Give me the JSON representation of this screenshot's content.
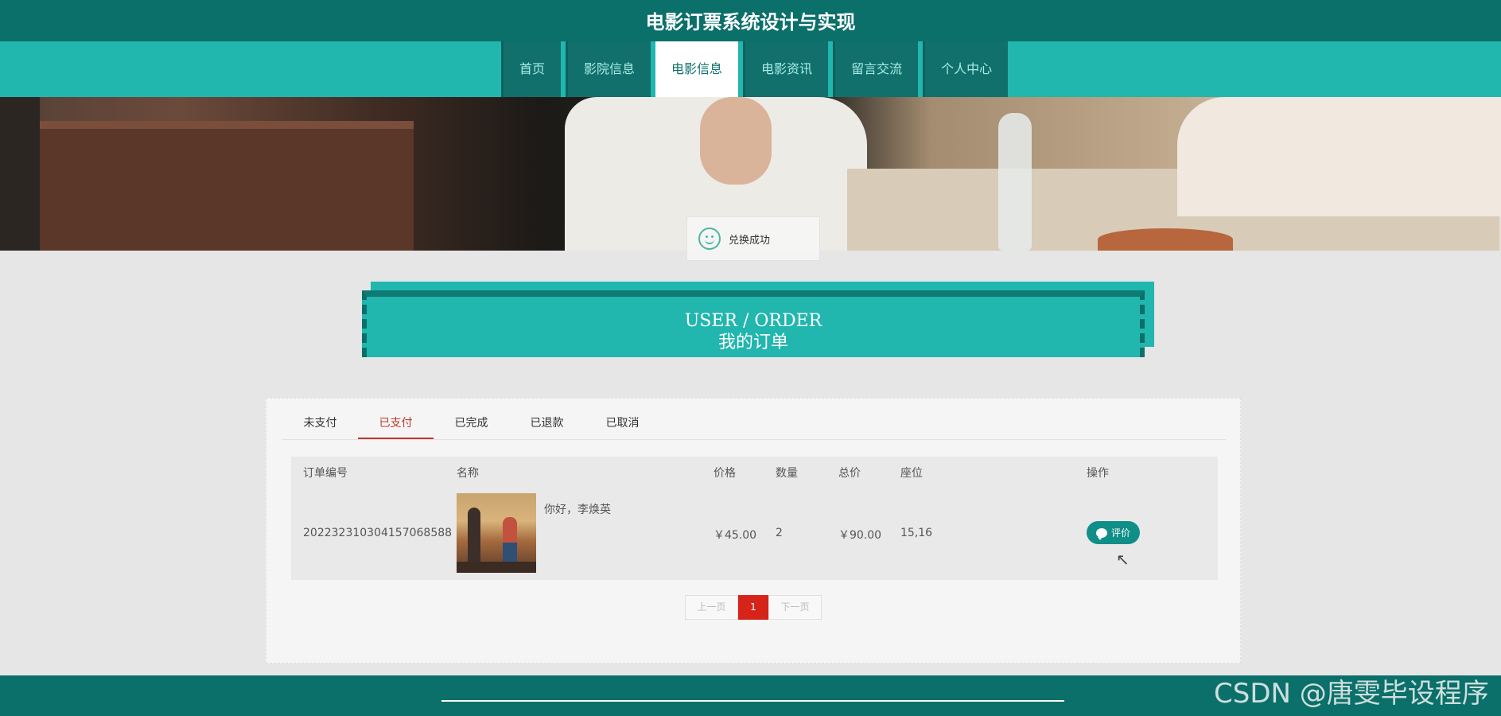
{
  "header": {
    "title": "电影订票系统设计与实现"
  },
  "nav": {
    "items": [
      {
        "label": "首页"
      },
      {
        "label": "影院信息"
      },
      {
        "label": "电影信息"
      },
      {
        "label": "电影资讯"
      },
      {
        "label": "留言交流"
      },
      {
        "label": "个人中心"
      }
    ],
    "active": "电影信息"
  },
  "toast": {
    "message": "兑换成功",
    "icon": "smile-icon"
  },
  "section": {
    "title_en": "USER / ORDER",
    "title_cn": "我的订单"
  },
  "tabs": {
    "items": [
      {
        "label": "未支付"
      },
      {
        "label": "已支付"
      },
      {
        "label": "已完成"
      },
      {
        "label": "已退款"
      },
      {
        "label": "已取消"
      }
    ],
    "active": "已支付"
  },
  "table": {
    "headers": [
      "订单编号",
      "名称",
      "价格",
      "数量",
      "总价",
      "座位",
      "操作"
    ],
    "rows": [
      {
        "order_no": "202232310304157068588",
        "name": "你好，李焕英",
        "price": "￥45.00",
        "quantity": "2",
        "total": "￥90.00",
        "seat": "15,16",
        "action": "评价"
      }
    ]
  },
  "pagination": {
    "prev": "上一页",
    "current": "1",
    "next": "下一页"
  },
  "watermark": "CSDN @唐雯毕设程序",
  "colors": {
    "primary_dark": "#0b6f6a",
    "primary": "#21b6ae",
    "accent_red": "#d6241b"
  }
}
